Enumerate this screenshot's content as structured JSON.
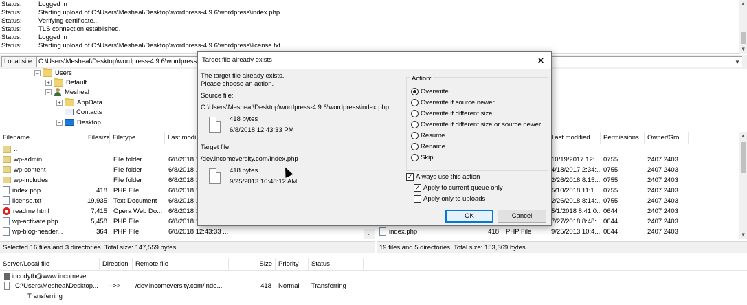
{
  "log": {
    "rows": [
      {
        "label": "Status:",
        "text": "Logged in"
      },
      {
        "label": "Status:",
        "text": "Starting upload of C:\\Users\\Mesheal\\Desktop\\wordpress-4.9.6\\wordpress\\index.php"
      },
      {
        "label": "Status:",
        "text": "Verifying certificate..."
      },
      {
        "label": "Status:",
        "text": "TLS connection established."
      },
      {
        "label": "Status:",
        "text": "Logged in"
      },
      {
        "label": "Status:",
        "text": "Starting upload of C:\\Users\\Mesheal\\Desktop\\wordpress-4.9.6\\wordpress\\license.txt"
      }
    ]
  },
  "local_site": {
    "label": "Local site:",
    "path": "C:\\Users\\Mesheal\\Desktop\\wordpress-4.9.6\\wordpress\\"
  },
  "tree": {
    "items": [
      {
        "label": "Users",
        "expander": "−",
        "icon": "folder-icon"
      },
      {
        "label": "Default",
        "expander": "+",
        "icon": "folder-icon"
      },
      {
        "label": "Mesheal",
        "expander": "−",
        "icon": "user-icon"
      },
      {
        "label": "AppData",
        "expander": "+",
        "icon": "folder-icon"
      },
      {
        "label": "Contacts",
        "expander": "",
        "icon": "contacts-icon"
      },
      {
        "label": "Desktop",
        "expander": "−",
        "icon": "desktop-icon"
      }
    ]
  },
  "local_files": {
    "columns": [
      "Filename",
      "Filesize",
      "Filetype",
      "Last modi"
    ],
    "rows": [
      {
        "name": "..",
        "size": "",
        "type": "",
        "modified": "",
        "icon": "folder-icon"
      },
      {
        "name": "wp-admin",
        "size": "",
        "type": "File folder",
        "modified": "6/8/2018 1",
        "icon": "folder-icon"
      },
      {
        "name": "wp-content",
        "size": "",
        "type": "File folder",
        "modified": "6/8/2018 1",
        "icon": "folder-icon"
      },
      {
        "name": "wp-includes",
        "size": "",
        "type": "File folder",
        "modified": "6/8/2018 1",
        "icon": "folder-icon"
      },
      {
        "name": "index.php",
        "size": "418",
        "type": "PHP File",
        "modified": "6/8/2018 1",
        "icon": "file-icon"
      },
      {
        "name": "license.txt",
        "size": "19,935",
        "type": "Text Document",
        "modified": "6/8/2018 1",
        "icon": "file-icon"
      },
      {
        "name": "readme.html",
        "size": "7,415",
        "type": "Opera Web Do...",
        "modified": "6/8/2018 1",
        "icon": "opera-icon"
      },
      {
        "name": "wp-activate.php",
        "size": "5,458",
        "type": "PHP File",
        "modified": "6/8/2018 1",
        "icon": "file-icon"
      },
      {
        "name": "wp-blog-header...",
        "size": "364",
        "type": "PHP File",
        "modified": "6/8/2018 12:43:33 ...",
        "icon": "file-icon"
      }
    ],
    "status": "Selected 16 files and 3 directories. Total size: 147,559 bytes"
  },
  "remote_files": {
    "columns": [
      "Last modified",
      "Permissions",
      "Owner/Gro..."
    ],
    "rows": [
      {
        "name": "",
        "size": "",
        "type": "",
        "modified": "",
        "perms": "",
        "owner": ""
      },
      {
        "name": "",
        "size": "",
        "type": "",
        "modified": "10/19/2017 12:...",
        "perms": "0755",
        "owner": "2407 2403"
      },
      {
        "name": "",
        "size": "",
        "type": "",
        "modified": "4/18/2017 2:34:...",
        "perms": "0755",
        "owner": "2407 2403"
      },
      {
        "name": "",
        "size": "",
        "type": "",
        "modified": "2/26/2018 8:15:...",
        "perms": "0755",
        "owner": "2407 2403"
      },
      {
        "name": "",
        "size": "",
        "type": "",
        "modified": "5/10/2018 11:1...",
        "perms": "0755",
        "owner": "2407 2403"
      },
      {
        "name": "",
        "size": "",
        "type": "",
        "modified": "2/26/2018 8:14:...",
        "perms": "0755",
        "owner": "2407 2403"
      },
      {
        "name": "",
        "size": "",
        "type": "",
        "modified": "5/1/2018 8:41:0...",
        "perms": "0644",
        "owner": "2407 2403"
      },
      {
        "name": "",
        "size": "",
        "type": "",
        "modified": "7/27/2018 8:48:...",
        "perms": "0644",
        "owner": "2407 2403"
      },
      {
        "name": "",
        "size": "",
        "type": "",
        "modified": "2/26/2018 8:14:...",
        "perms": "0644",
        "owner": "2407 2403"
      },
      {
        "name": "index.php",
        "size": "418",
        "type": "PHP File",
        "modified": "9/25/2013 10:4...",
        "perms": "0644",
        "owner": "2407 2403"
      }
    ],
    "status": "19 files and 5 directories. Total size: 153,369 bytes"
  },
  "queue": {
    "columns": [
      "Server/Local file",
      "Direction",
      "Remote file",
      "Size",
      "Priority",
      "Status"
    ],
    "server": "incodytb@www.incomever...",
    "row": {
      "local": "C:\\Users\\Mesheal\\Desktop...",
      "direction": "-->>",
      "remote": "/dev.incomeversity.com/inde...",
      "size": "418",
      "priority": "Normal",
      "status": "Transferring"
    },
    "sub_status": "Transferring"
  },
  "dialog": {
    "title": "Target file already exists",
    "close_glyph": "✕",
    "message_line1": "The target file already exists.",
    "message_line2": "Please choose an action.",
    "source_label": "Source file:",
    "source_path": "C:\\Users\\Mesheal\\Desktop\\wordpress-4.9.6\\wordpress\\index.php",
    "source_size": "418 bytes",
    "source_date": "6/8/2018 12:43:33 PM",
    "target_label": "Target file:",
    "target_path": "/dev.incomeversity.com/index.php",
    "target_size": "418 bytes",
    "target_date": "9/25/2013 10:48:12 AM",
    "action_label": "Action:",
    "options": [
      {
        "label": "Overwrite",
        "selected": true
      },
      {
        "label": "Overwrite if source newer",
        "selected": false
      },
      {
        "label": "Overwrite if different size",
        "selected": false
      },
      {
        "label": "Overwrite if different size or source newer",
        "selected": false
      },
      {
        "label": "Resume",
        "selected": false
      },
      {
        "label": "Rename",
        "selected": false
      },
      {
        "label": "Skip",
        "selected": false
      }
    ],
    "always_use": {
      "label": "Always use this action",
      "checked": true
    },
    "apply_queue": {
      "label": "Apply to current queue only",
      "checked": true
    },
    "apply_uploads": {
      "label": "Apply only to uploads",
      "checked": false
    },
    "ok_label": "OK",
    "cancel_label": "Cancel",
    "check_glyph": "✓"
  }
}
